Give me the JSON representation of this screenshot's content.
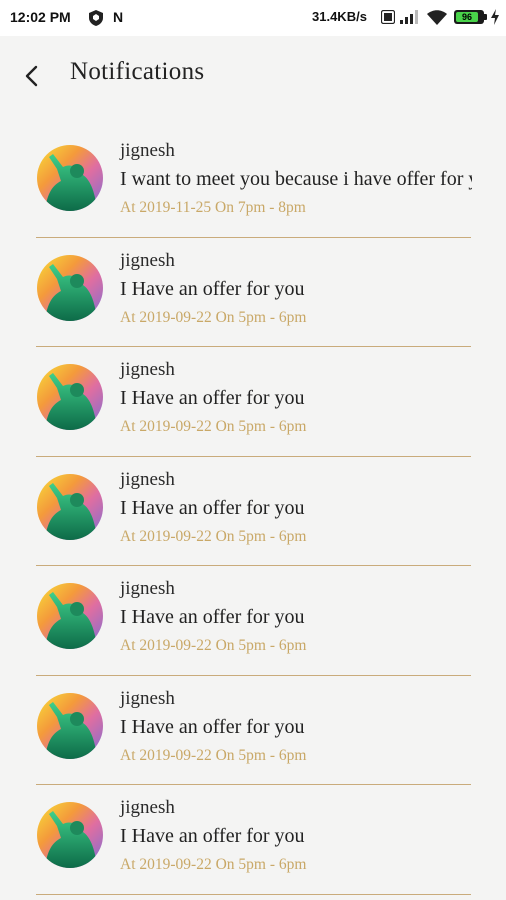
{
  "status_bar": {
    "time": "12:02 PM",
    "network_letter": "N",
    "speed": "31.4KB/s",
    "battery_level": "96",
    "icons": [
      "shield-icon",
      "hd-icon",
      "signal-icon",
      "wifi-icon",
      "battery-icon",
      "charging-bolt-icon"
    ]
  },
  "header": {
    "title": "Notifications",
    "back_icon": "chevron-left-icon"
  },
  "notifications": [
    {
      "name": "jignesh",
      "message": "I want to meet you because i have offer for you",
      "time": "At 2019-11-25 On 7pm - 8pm"
    },
    {
      "name": "jignesh",
      "message": "I Have an offer for you",
      "time": "At 2019-09-22 On 5pm - 6pm"
    },
    {
      "name": "jignesh",
      "message": "I Have an offer for you",
      "time": "At 2019-09-22 On 5pm - 6pm"
    },
    {
      "name": "jignesh",
      "message": "I Have an offer for you",
      "time": "At 2019-09-22 On 5pm - 6pm"
    },
    {
      "name": "jignesh",
      "message": "I Have an offer for you",
      "time": "At 2019-09-22 On 5pm - 6pm"
    },
    {
      "name": "jignesh",
      "message": "I Have an offer for you",
      "time": "At 2019-09-22 On 5pm - 6pm"
    },
    {
      "name": "jignesh",
      "message": "I Have an offer for you",
      "time": "At 2019-09-22 On 5pm - 6pm"
    }
  ],
  "colors": {
    "background": "#f4f4f3",
    "divider": "#c9ab7b",
    "time_text": "#c9a867",
    "battery": "#49d34a"
  }
}
